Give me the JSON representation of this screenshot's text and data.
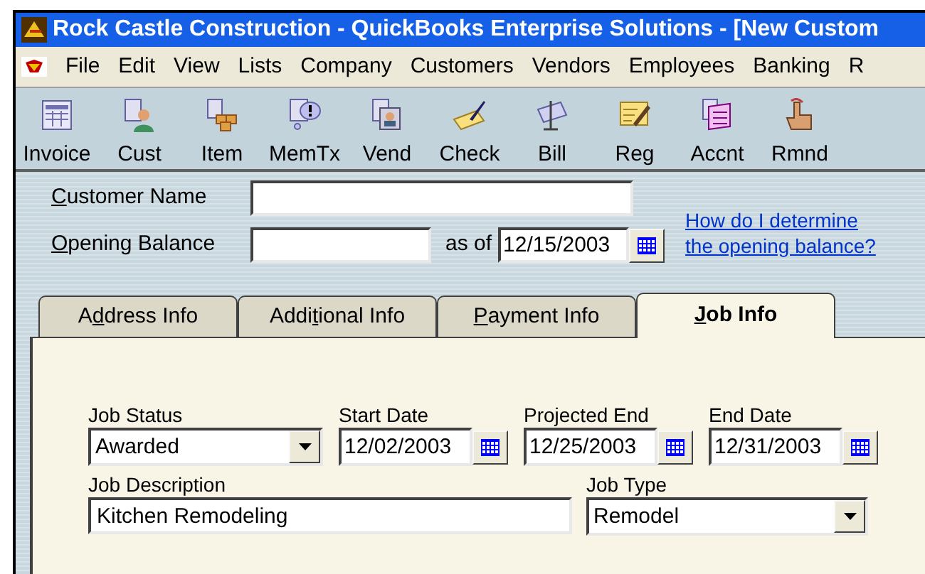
{
  "window": {
    "title": "Rock Castle Construction - QuickBooks Enterprise Solutions - [New Custom"
  },
  "menu": [
    "File",
    "Edit",
    "View",
    "Lists",
    "Company",
    "Customers",
    "Vendors",
    "Employees",
    "Banking",
    "R"
  ],
  "toolbar": [
    {
      "label": "Invoice"
    },
    {
      "label": "Cust"
    },
    {
      "label": "Item"
    },
    {
      "label": "MemTx"
    },
    {
      "label": "Vend"
    },
    {
      "label": "Check"
    },
    {
      "label": "Bill"
    },
    {
      "label": "Reg"
    },
    {
      "label": "Accnt"
    },
    {
      "label": "Rmnd"
    }
  ],
  "customer_name": {
    "label": {
      "key": "C",
      "post": "ustomer Name"
    }
  },
  "opening_balance": {
    "label": {
      "key": "O",
      "post": "pening Balance"
    },
    "as_of_label": "as of",
    "as_of_date": "12/15/2003"
  },
  "help_link": [
    "How do I determine",
    "the opening balance?"
  ],
  "tabs": [
    {
      "label": {
        "pre": "A",
        "key": "d",
        "post": "dress Info"
      },
      "selected": false
    },
    {
      "label": {
        "pre": "Addi",
        "key": "t",
        "post": "ional Info"
      },
      "selected": false
    },
    {
      "label": {
        "key": "P",
        "post": "ayment Info"
      },
      "selected": false
    },
    {
      "label": {
        "key": "J",
        "post": "ob Info"
      },
      "selected": true
    }
  ],
  "job_info": {
    "job_status": {
      "label": "Job Status",
      "value": "Awarded"
    },
    "dates": [
      {
        "label": "Start Date",
        "value": "12/02/2003"
      },
      {
        "label": "Projected End",
        "value": "12/25/2003"
      },
      {
        "label": "End Date",
        "value": "12/31/2003"
      }
    ],
    "job_description": {
      "label": "Job Description",
      "value": "Kitchen Remodeling"
    },
    "job_type": {
      "label": "Job Type",
      "value": "Remodel"
    }
  }
}
